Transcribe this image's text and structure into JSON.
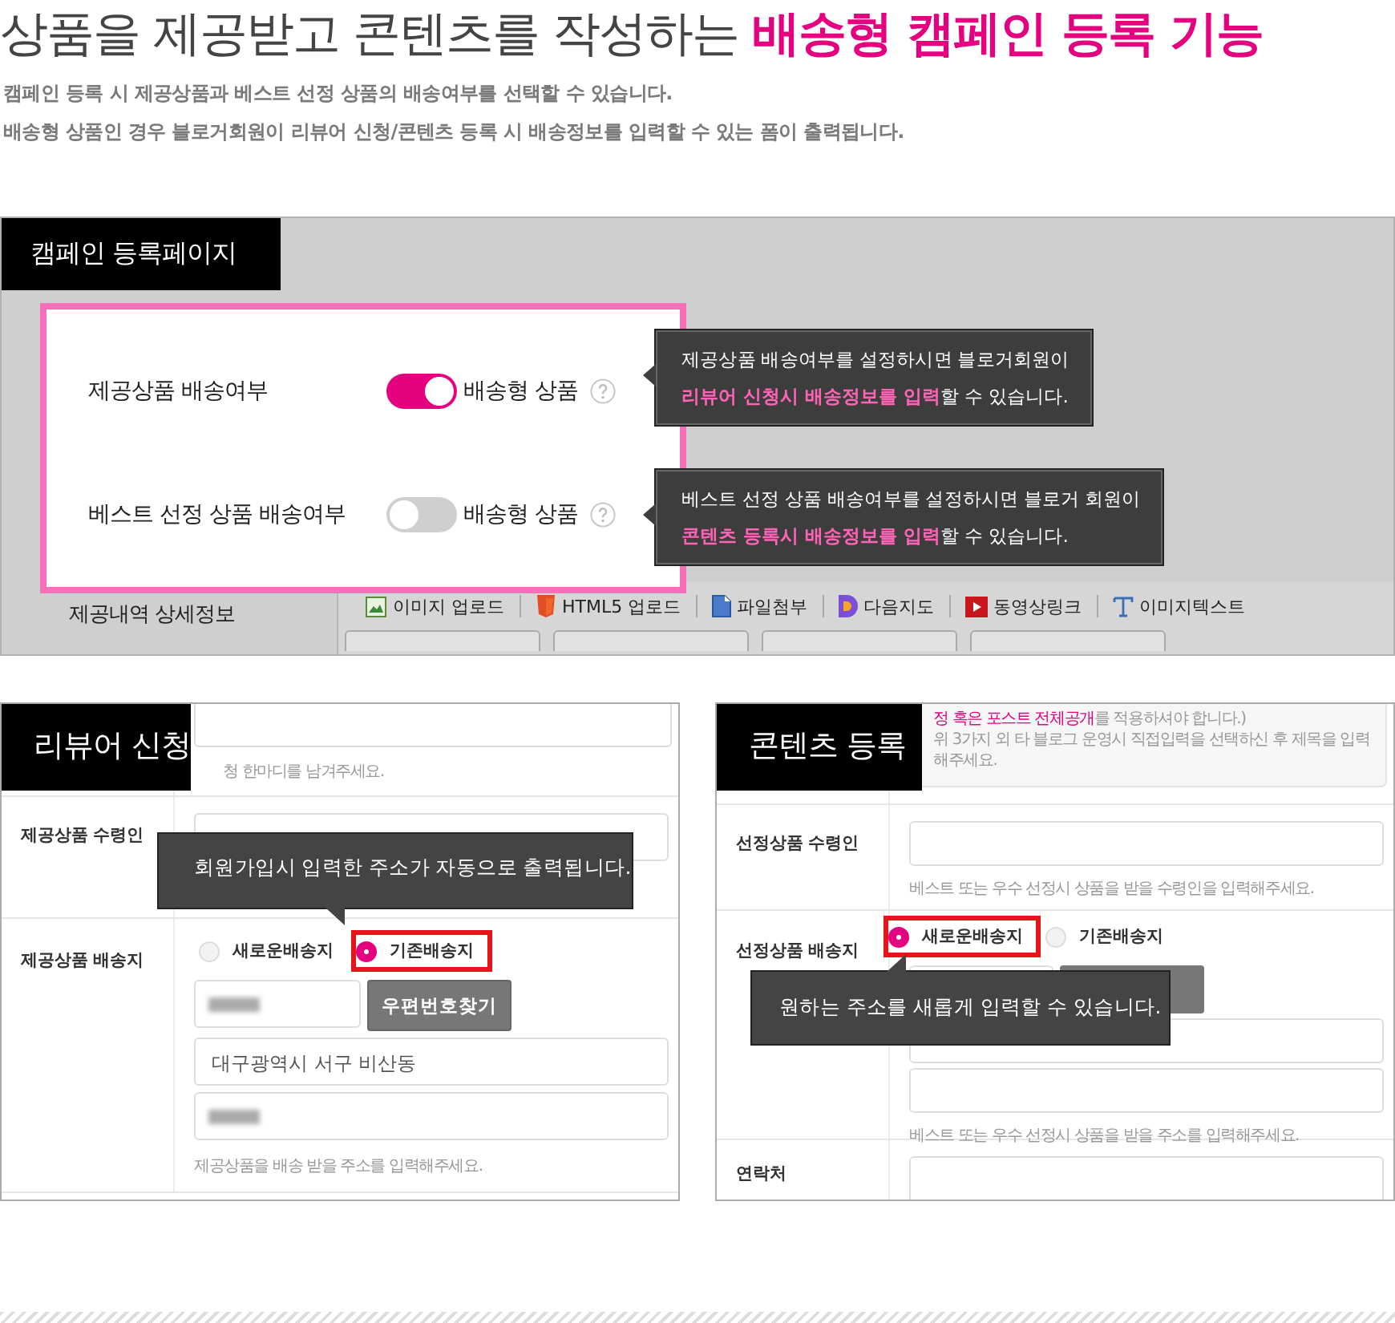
{
  "headline": {
    "plain": "상품을 제공받고 콘텐츠를 작성하는",
    "highlight": "배송형 캠페인 등록 기능"
  },
  "description": [
    "캠페인 등록 시 제공상품과 베스트 선정 상품의 배송여부를 선택할 수 있습니다.",
    "배송형 상품인 경우 블로거회원이 리뷰어 신청/콘텐츠 등록 시 배송정보를 입력할 수 있는 폼이 출력됩니다."
  ],
  "campaign_page": {
    "title": "캠페인 등록페이지",
    "settings": [
      {
        "label": "제공상품 배송여부",
        "on": true,
        "option": "배송형 상품",
        "tooltip": [
          "제공상품 배송여부를 설정하시면 블로거회원이",
          "**리뷰어 신청시 배송정보를 입력**할 수 있습니다."
        ]
      },
      {
        "label": "베스트 선정 상품 배송여부",
        "on": false,
        "option": "배송형 상품",
        "tooltip": [
          "베스트 선정 상품 배송여부를 설정하시면 블로거 회원이",
          "**콘텐츠 등록시 배송정보를 입력**할 수 있습니다."
        ]
      }
    ],
    "detail_label": "제공내역 상세정보",
    "toolbar": [
      {
        "kind": "image",
        "label": "이미지 업로드"
      },
      {
        "kind": "html5",
        "label": "HTML5 업로드"
      },
      {
        "kind": "file",
        "label": "파일첨부"
      },
      {
        "kind": "map",
        "label": "다음지도"
      },
      {
        "kind": "video",
        "label": "동영상링크"
      },
      {
        "kind": "text",
        "label": "이미지텍스트"
      }
    ]
  },
  "reviewer_panel": {
    "title": "리뷰어 신청",
    "top_hint": "청 한마디를 남겨주세요.",
    "recipient_label": "제공상품 수령인",
    "address_label": "제공상품 배송지",
    "radios": [
      {
        "label": "새로운배송지",
        "selected": false
      },
      {
        "label": "기존배송지",
        "selected": true
      }
    ],
    "zip_button": "우편번호찾기",
    "address_value": "대구광역시 서구 비산동",
    "address_hint": "제공상품을 배송 받을 주소를 입력해주세요.",
    "tooltip": "회원가입시 입력한 주소가 자동으로 출력됩니다."
  },
  "content_panel": {
    "title": "콘텐츠 등록",
    "notice": [
      "**정 혹은 포스트 전체공개**를 적용하셔야 합니다.)",
      "위 3가지 외 타 블로그 운영시 직접입력을 선택하신 후 제목을 입력해주세요."
    ],
    "recipient_label": "선정상품 수령인",
    "recipient_hint": "베스트 또는 우수 선정시 상품을 받을 수령인을 입력해주세요.",
    "address_label": "선정상품 배송지",
    "radios": [
      {
        "label": "새로운배송지",
        "selected": true
      },
      {
        "label": "기존배송지",
        "selected": false
      }
    ],
    "address_hint": "베스트 또는 우수 선정시 상품을 받을 주소를 입력해주세요.",
    "contact_label": "연락처",
    "tooltip": "원하는 주소를 새롭게 입력할 수 있습니다."
  }
}
